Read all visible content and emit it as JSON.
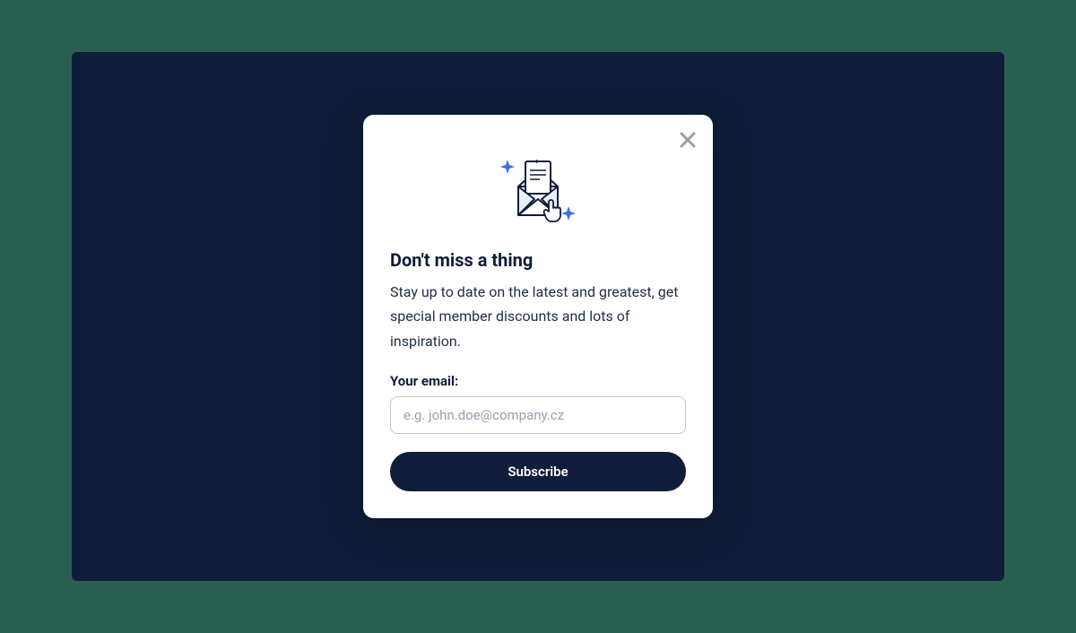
{
  "modal": {
    "title": "Don't miss a thing",
    "description": "Stay up to date on the latest and greatest, get special member discounts and lots of inspiration.",
    "email_label": "Your email:",
    "email_placeholder": "e.g. john.doe@company.cz",
    "email_value": "",
    "subscribe_label": "Subscribe"
  }
}
